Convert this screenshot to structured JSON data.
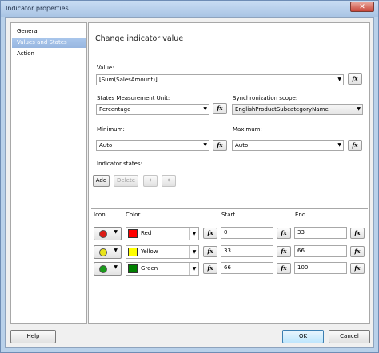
{
  "window": {
    "title": "Indicator properties"
  },
  "nav": {
    "items": [
      {
        "label": "General"
      },
      {
        "label": "Values and States"
      },
      {
        "label": "Action"
      }
    ]
  },
  "main": {
    "heading": "Change indicator value",
    "value": {
      "label": "Value:",
      "text": "[Sum(SalesAmount)]"
    },
    "measurement_unit": {
      "label": "States Measurement Unit:",
      "selected": "Percentage"
    },
    "sync_scope": {
      "label": "Synchronization scope:",
      "selected": "EnglishProductSubcategoryName"
    },
    "minimum": {
      "label": "Minimum:",
      "selected": "Auto"
    },
    "maximum": {
      "label": "Maximum:",
      "selected": "Auto"
    },
    "states_label": "Indicator states:",
    "toolbar": {
      "add_label": "Add",
      "delete_label": "Delete",
      "move_up_glyph": "✦",
      "move_down_glyph": "✦"
    },
    "fx_label": "fx",
    "grid": {
      "headers": {
        "icon": "Icon",
        "color": "Color",
        "start": "Start",
        "end": "End"
      },
      "rows": [
        {
          "icon_color": "#dd1b16",
          "color_name": "Red",
          "color_hex": "#ff0000",
          "start": "0",
          "end": "33"
        },
        {
          "icon_color": "#e8e31a",
          "color_name": "Yellow",
          "color_hex": "#ffff00",
          "start": "33",
          "end": "66"
        },
        {
          "icon_color": "#1a9a1a",
          "color_name": "Green",
          "color_hex": "#008000",
          "start": "66",
          "end": "100"
        }
      ]
    }
  },
  "footer": {
    "help_label": "Help",
    "ok_label": "OK",
    "cancel_label": "Cancel"
  },
  "colors": {
    "accent": "#3c7fb1",
    "window_frame": "#b9d1ea"
  }
}
